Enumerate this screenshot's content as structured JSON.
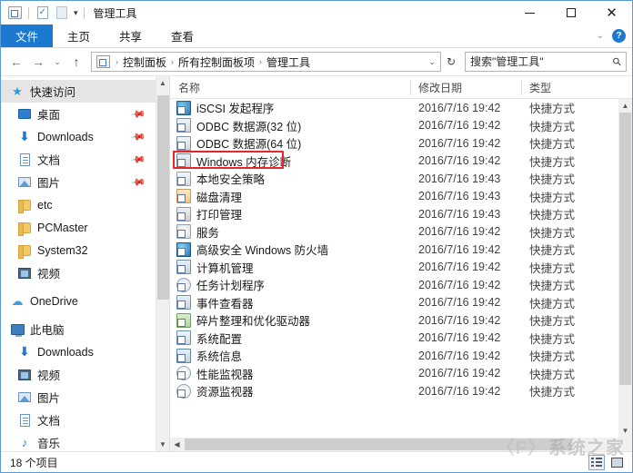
{
  "window": {
    "title": "管理工具",
    "quick_access": [
      {
        "name": "folder-properties-icon"
      },
      {
        "name": "properties-icon"
      },
      {
        "name": "new-folder-icon"
      },
      {
        "name": "chevron-down-icon"
      }
    ],
    "controls": {
      "minimize": "—",
      "maximize": "□",
      "close": "✕"
    }
  },
  "ribbon": {
    "tabs": [
      {
        "label": "文件",
        "active": true
      },
      {
        "label": "主页",
        "active": false
      },
      {
        "label": "共享",
        "active": false
      },
      {
        "label": "查看",
        "active": false
      }
    ],
    "collapse_label": "⌄",
    "help_label": "?"
  },
  "address": {
    "back": "←",
    "forward": "→",
    "recent": "⌄",
    "up": "↑",
    "crumbs": [
      "控制面板",
      "所有控制面板项",
      "管理工具"
    ],
    "separator": "›",
    "dropdown": "⌄",
    "refresh": "↻"
  },
  "search": {
    "placeholder": "搜索\"管理工具\"",
    "value": "",
    "icon": "search-icon"
  },
  "sidebar": {
    "items": [
      {
        "label": "快速访问",
        "icon": "star-icon",
        "level": 0,
        "selected": true,
        "pinned": false
      },
      {
        "label": "桌面",
        "icon": "desktop-icon",
        "level": 1,
        "selected": false,
        "pinned": true
      },
      {
        "label": "Downloads",
        "icon": "download-icon",
        "level": 1,
        "selected": false,
        "pinned": true
      },
      {
        "label": "文档",
        "icon": "document-icon",
        "level": 1,
        "selected": false,
        "pinned": true
      },
      {
        "label": "图片",
        "icon": "picture-icon",
        "level": 1,
        "selected": false,
        "pinned": true
      },
      {
        "label": "etc",
        "icon": "folder-icon",
        "level": 1,
        "selected": false,
        "pinned": false
      },
      {
        "label": "PCMaster",
        "icon": "folder-icon",
        "level": 1,
        "selected": false,
        "pinned": false
      },
      {
        "label": "System32",
        "icon": "folder-icon",
        "level": 1,
        "selected": false,
        "pinned": false
      },
      {
        "label": "视频",
        "icon": "video-icon",
        "level": 1,
        "selected": false,
        "pinned": false
      },
      {
        "label": "OneDrive",
        "icon": "cloud-icon",
        "level": 0,
        "selected": false,
        "pinned": false
      },
      {
        "label": "此电脑",
        "icon": "computer-icon",
        "level": 0,
        "selected": false,
        "pinned": false
      },
      {
        "label": "Downloads",
        "icon": "download-icon",
        "level": 1,
        "selected": false,
        "pinned": false
      },
      {
        "label": "视频",
        "icon": "video-icon",
        "level": 1,
        "selected": false,
        "pinned": false
      },
      {
        "label": "图片",
        "icon": "picture-icon",
        "level": 1,
        "selected": false,
        "pinned": false
      },
      {
        "label": "文档",
        "icon": "document-icon",
        "level": 1,
        "selected": false,
        "pinned": false
      },
      {
        "label": "音乐",
        "icon": "music-icon",
        "level": 1,
        "selected": false,
        "pinned": false
      }
    ]
  },
  "file_list": {
    "columns": [
      {
        "label": "名称",
        "key": "name"
      },
      {
        "label": "修改日期",
        "key": "date"
      },
      {
        "label": "类型",
        "key": "type"
      }
    ],
    "sort_indicator": "^",
    "rows": [
      {
        "name": "iSCSI 发起程序",
        "date": "2016/7/16 19:42",
        "type": "快捷方式",
        "icon": "globe",
        "highlighted": false
      },
      {
        "name": "ODBC 数据源(32 位)",
        "date": "2016/7/16 19:42",
        "type": "快捷方式",
        "icon": "odbc",
        "highlighted": false
      },
      {
        "name": "ODBC 数据源(64 位)",
        "date": "2016/7/16 19:42",
        "type": "快捷方式",
        "icon": "odbc",
        "highlighted": false
      },
      {
        "name": "Windows 内存诊断",
        "date": "2016/7/16 19:42",
        "type": "快捷方式",
        "icon": "mem",
        "highlighted": true
      },
      {
        "name": "本地安全策略",
        "date": "2016/7/16 19:43",
        "type": "快捷方式",
        "icon": "shield",
        "highlighted": false
      },
      {
        "name": "磁盘清理",
        "date": "2016/7/16 19:43",
        "type": "快捷方式",
        "icon": "broom",
        "highlighted": false
      },
      {
        "name": "打印管理",
        "date": "2016/7/16 19:43",
        "type": "快捷方式",
        "icon": "print",
        "highlighted": false
      },
      {
        "name": "服务",
        "date": "2016/7/16 19:42",
        "type": "快捷方式",
        "icon": "gear",
        "highlighted": false
      },
      {
        "name": "高级安全 Windows 防火墙",
        "date": "2016/7/16 19:42",
        "type": "快捷方式",
        "icon": "fire",
        "highlighted": false
      },
      {
        "name": "计算机管理",
        "date": "2016/7/16 19:42",
        "type": "快捷方式",
        "icon": "mgmt",
        "highlighted": false
      },
      {
        "name": "任务计划程序",
        "date": "2016/7/16 19:42",
        "type": "快捷方式",
        "icon": "clock",
        "highlighted": false
      },
      {
        "name": "事件查看器",
        "date": "2016/7/16 19:42",
        "type": "快捷方式",
        "icon": "eventv",
        "highlighted": false
      },
      {
        "name": "碎片整理和优化驱动器",
        "date": "2016/7/16 19:42",
        "type": "快捷方式",
        "icon": "defrag",
        "highlighted": false
      },
      {
        "name": "系统配置",
        "date": "2016/7/16 19:42",
        "type": "快捷方式",
        "icon": "cfg",
        "highlighted": false
      },
      {
        "name": "系统信息",
        "date": "2016/7/16 19:42",
        "type": "快捷方式",
        "icon": "info",
        "highlighted": false
      },
      {
        "name": "性能监视器",
        "date": "2016/7/16 19:42",
        "type": "快捷方式",
        "icon": "perf",
        "highlighted": false
      },
      {
        "name": "资源监视器",
        "date": "2016/7/16 19:42",
        "type": "快捷方式",
        "icon": "perf",
        "highlighted": false
      }
    ]
  },
  "statusbar": {
    "item_count": "18 个项目",
    "view_details": "details-view-icon",
    "view_large": "large-icons-view-icon"
  },
  "watermark": {
    "text": "系统之家",
    "mark": "〈F〉"
  },
  "colors": {
    "accent": "#1b79d0",
    "highlight_red": "#e8262a",
    "window_border": "#5b9bd5",
    "selection_gray": "#e5e5e5"
  }
}
